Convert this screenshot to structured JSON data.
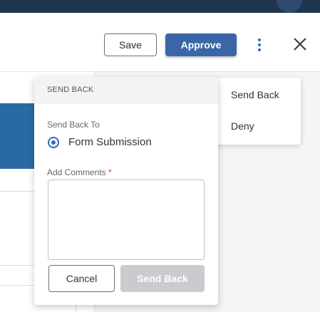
{
  "header": {
    "save_label": "Save",
    "approve_label": "Approve",
    "more_icon": "kebab-vertical-icon",
    "close_icon": "close-icon"
  },
  "actions_menu": {
    "items": [
      {
        "label": "Send Back"
      },
      {
        "label": "Deny"
      }
    ]
  },
  "send_back_panel": {
    "title": "SEND BACK",
    "send_back_to_label": "Send Back To",
    "selected_option": "Form Submission",
    "comments_label": "Add Comments",
    "required_marker": "*",
    "comments_value": "",
    "cancel_label": "Cancel",
    "submit_label": "Send Back"
  },
  "colors": {
    "accent": "#3a66a8",
    "topbar": "#1f3552",
    "disabled": "#c9cbce",
    "required": "#d93838"
  }
}
